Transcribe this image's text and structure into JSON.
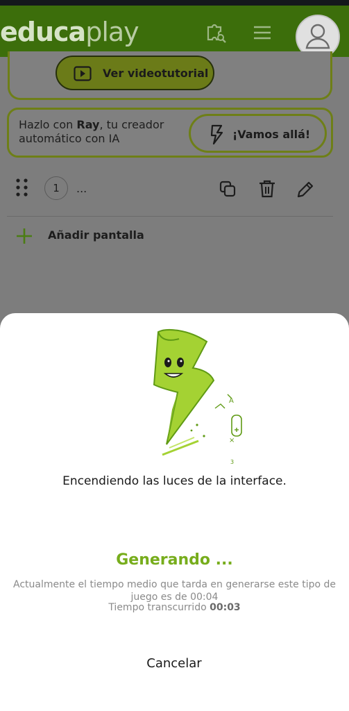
{
  "header": {
    "logo_part1": "educa",
    "logo_part2": "play",
    "icons": [
      "puzzle-search-icon",
      "hamburger-menu-icon",
      "user-avatar-icon"
    ]
  },
  "page": {
    "video_button_label": "Ver videotutorial",
    "ray_text_prefix": "Hazlo con ",
    "ray_name": "Ray",
    "ray_text_suffix": ", tu creador automático con IA",
    "ray_button_label": "¡Vamos allá!",
    "screen_number": "1",
    "screen_title": "...",
    "add_screen_label": "Añadir pantalla"
  },
  "sheet": {
    "message": "Encendiendo las luces de la interface.",
    "status_title": "Generando ...",
    "info_text": "Actualmente el tiempo medio que tarda en generarse este tipo de juego es de 00:04",
    "elapsed_label": "Tiempo transcurrido ",
    "elapsed_value": "00:03",
    "cancel_label": "Cancelar"
  },
  "colors": {
    "header_bg": "#3c6e0b",
    "accent_green": "#77ad1c",
    "overlay_gray": "#7d7d7d"
  }
}
